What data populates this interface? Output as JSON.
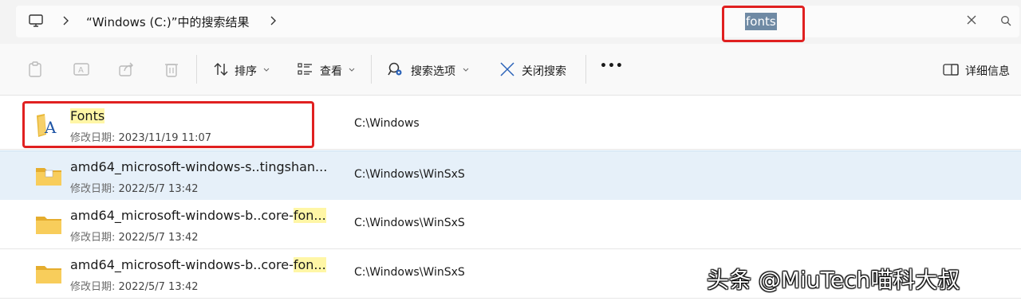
{
  "address_bar": {
    "breadcrumb": "“Windows (C:)”中的搜索结果",
    "search_value": "fonts"
  },
  "toolbar": {
    "sort_label": "排序",
    "view_label": "查看",
    "search_options_label": "搜索选项",
    "close_search_label": "关闭搜索",
    "more_label": "•••",
    "details_label": "详细信息"
  },
  "files": [
    {
      "name_pre": "",
      "name_hl": "Fonts",
      "name_post": "",
      "date_label": "修改日期:",
      "date": "2023/11/19 11:07",
      "path": "C:\\Windows",
      "icon": "fonts-folder-icon",
      "selected": false
    },
    {
      "name_pre": "amd64_microsoft-windows-s..tingshan...",
      "name_hl": "",
      "name_post": "",
      "date_label": "修改日期:",
      "date": "2022/5/7 13:42",
      "path": "C:\\Windows\\WinSxS",
      "icon": "folder-icon",
      "selected": true
    },
    {
      "name_pre": "amd64_microsoft-windows-b..core-",
      "name_hl": "fon...",
      "name_post": "",
      "date_label": "修改日期:",
      "date": "2022/5/7 13:42",
      "path": "C:\\Windows\\WinSxS",
      "icon": "folder-icon",
      "selected": false
    },
    {
      "name_pre": "amd64_microsoft-windows-b..core-",
      "name_hl": "fon...",
      "name_post": "",
      "date_label": "修改日期:",
      "date": "2022/5/7 13:42",
      "path": "C:\\Windows\\WinSxS",
      "icon": "folder-icon",
      "selected": false
    }
  ],
  "watermark": "头条 @MiuTech喵科大叔",
  "colors": {
    "highlight_box": "#e02020",
    "match_highlight": "#fff6a6",
    "selected_row": "#e6f0f9",
    "folder": "#f6c443"
  }
}
